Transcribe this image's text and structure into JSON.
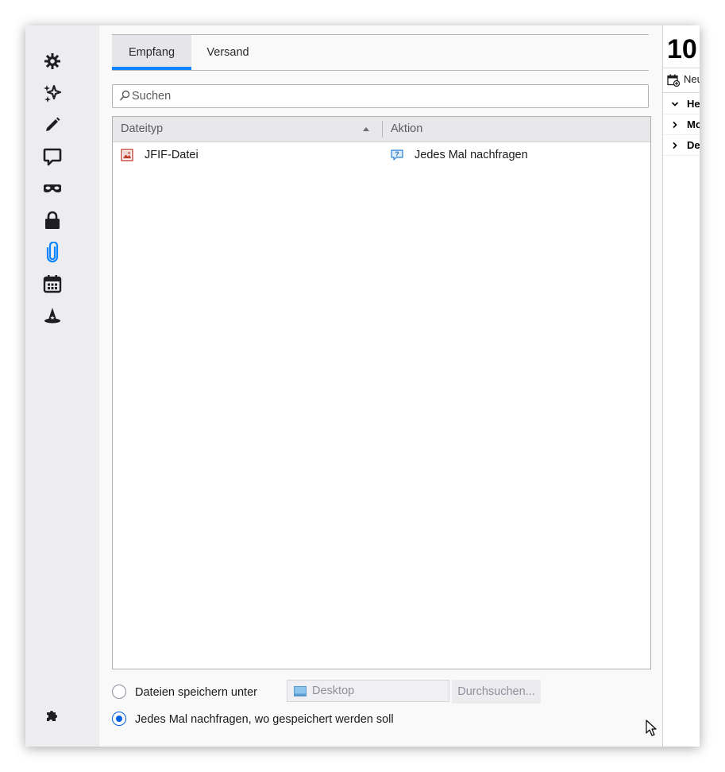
{
  "sidebar": {
    "items": [
      {
        "name": "general",
        "icon": "gear-icon"
      },
      {
        "name": "composition",
        "icon": "sparkle-icon"
      },
      {
        "name": "editing",
        "icon": "pencil-icon"
      },
      {
        "name": "chat",
        "icon": "chat-icon"
      },
      {
        "name": "privacy",
        "icon": "mask-icon"
      },
      {
        "name": "security",
        "icon": "lock-icon"
      },
      {
        "name": "attachments",
        "icon": "paperclip-icon",
        "active": true
      },
      {
        "name": "calendar",
        "icon": "calendar-icon"
      },
      {
        "name": "magic",
        "icon": "wizard-hat-icon"
      }
    ],
    "bottom_icon": "puzzle-icon",
    "active_color": "#0a84ff"
  },
  "tabs": [
    {
      "label": "Empfang",
      "active": true
    },
    {
      "label": "Versand",
      "active": false
    }
  ],
  "search": {
    "placeholder": "Suchen",
    "value": ""
  },
  "table": {
    "columns": [
      "Dateityp",
      "Aktion"
    ],
    "sorted_column": "Dateityp",
    "rows": [
      {
        "type": "JFIF-Datei",
        "type_icon": "image-file-icon",
        "action": "Jedes Mal nachfragen",
        "action_icon": "question-icon"
      }
    ]
  },
  "options": {
    "save_to": {
      "label": "Dateien speichern unter",
      "folder": "Desktop",
      "folder_icon": "folder-icon",
      "browse_label": "Durchsuchen...",
      "checked": false
    },
    "ask": {
      "label": "Jedes Mal nachfragen, wo gespeichert werden soll",
      "checked": true
    }
  },
  "right_pane": {
    "date": "10",
    "new_label": "Neu",
    "items": [
      {
        "label": "He",
        "expanded": true
      },
      {
        "label": "Mo",
        "expanded": false
      },
      {
        "label": "De",
        "expanded": false
      }
    ]
  },
  "colors": {
    "accent": "#0a84ff",
    "radio_checked": "#0060df"
  }
}
